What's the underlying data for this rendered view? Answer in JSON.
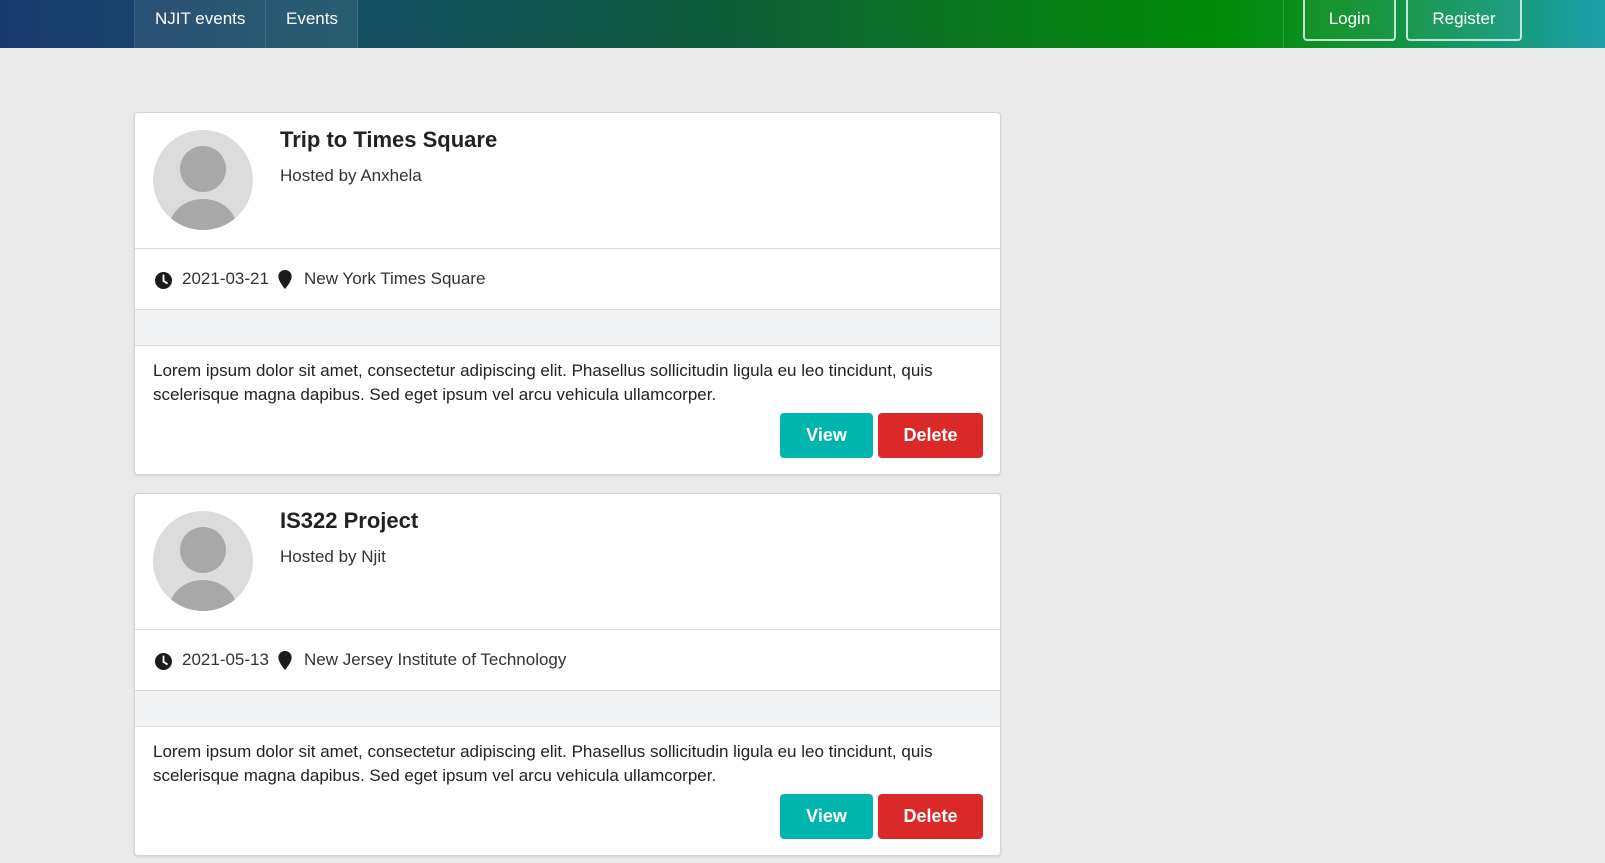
{
  "nav": {
    "brand": "NJIT events",
    "events": "Events",
    "login": "Login",
    "register": "Register"
  },
  "events": [
    {
      "title": "Trip to Times Square",
      "host": "Hosted by Anxhela",
      "date": "2021-03-21",
      "venue": "New York Times Square",
      "description": "Lorem ipsum dolor sit amet, consectetur adipiscing elit. Phasellus sollicitudin ligula eu leo tincidunt, quis scelerisque magna dapibus. Sed eget ipsum vel arcu vehicula ullamcorper.",
      "view_label": "View",
      "delete_label": "Delete"
    },
    {
      "title": "IS322 Project",
      "host": "Hosted by Njit",
      "date": "2021-05-13",
      "venue": "New Jersey Institute of Technology",
      "description": "Lorem ipsum dolor sit amet, consectetur adipiscing elit. Phasellus sollicitudin ligula eu leo tincidunt, quis scelerisque magna dapibus. Sed eget ipsum vel arcu vehicula ullamcorper.",
      "view_label": "View",
      "delete_label": "Delete"
    }
  ],
  "icons": {
    "clock": "clock-icon",
    "pin": "map-marker-icon",
    "avatar": "user-avatar-placeholder"
  },
  "colors": {
    "view": "#00b5ad",
    "delete": "#db2828",
    "background": "#eaeaea"
  }
}
